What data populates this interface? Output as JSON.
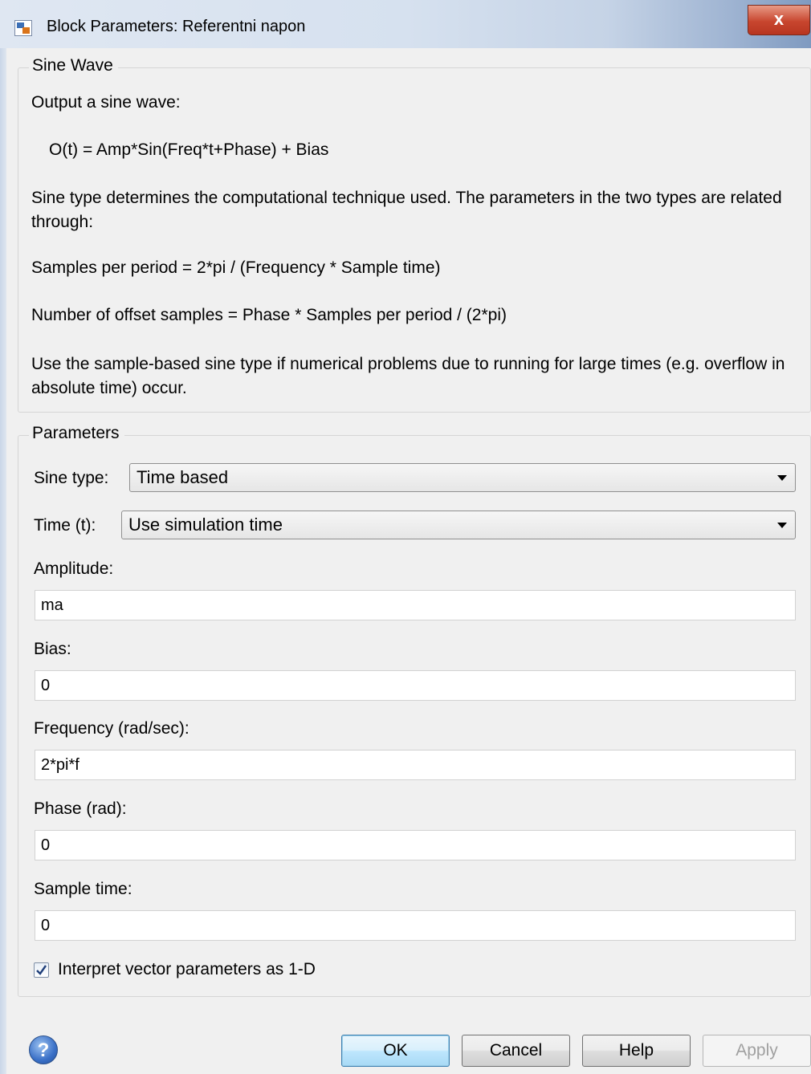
{
  "window": {
    "title": "Block Parameters: Referentni napon",
    "close_glyph": "x"
  },
  "description": {
    "legend": "Sine Wave",
    "line1": "Output a sine wave:",
    "formula": "O(t) = Amp*Sin(Freq*t+Phase) + Bias",
    "para1": "Sine type determines the computational technique used. The parameters in the two types are related through:",
    "line2": "Samples per period = 2*pi / (Frequency * Sample time)",
    "line3": "Number of offset samples = Phase * Samples per period / (2*pi)",
    "para2": "Use the sample-based sine type if numerical problems due to running for large times (e.g. overflow in absolute time) occur."
  },
  "parameters": {
    "legend": "Parameters",
    "sine_type_label": "Sine type:",
    "sine_type_value": "Time based",
    "time_label": "Time (t):",
    "time_value": "Use simulation time",
    "amplitude_label": "Amplitude:",
    "amplitude_value": "ma",
    "bias_label": "Bias:",
    "bias_value": "0",
    "frequency_label": "Frequency (rad/sec):",
    "frequency_value": "2*pi*f",
    "phase_label": "Phase (rad):",
    "phase_value": "0",
    "sample_time_label": "Sample time:",
    "sample_time_value": "0",
    "interpret_label": "Interpret vector parameters as 1-D",
    "interpret_checked": true
  },
  "buttons": {
    "help_icon": "?",
    "ok": "OK",
    "cancel": "Cancel",
    "help": "Help",
    "apply": "Apply"
  }
}
